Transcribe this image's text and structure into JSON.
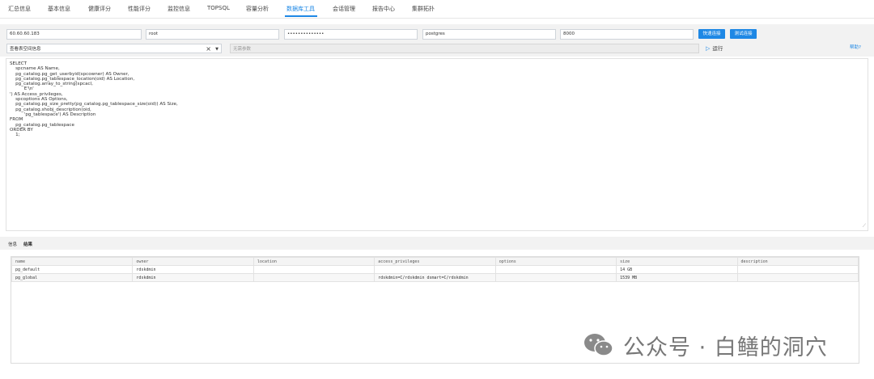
{
  "nav": {
    "tabs": [
      "汇总信息",
      "基本信息",
      "健康评分",
      "性能评分",
      "监控信息",
      "TOPSQL",
      "容量分析",
      "数据库工具",
      "会话管理",
      "报告中心",
      "集群拓扑"
    ],
    "active": "数据库工具"
  },
  "connection": {
    "host": "60.60.60.183",
    "user": "root",
    "password": "••••••••••••••",
    "database": "postgres",
    "port": "8000",
    "quick_connect_label": "快速连接",
    "test_connect_label": "测试连接"
  },
  "query": {
    "selected": "查看表空间信息",
    "params_placeholder": "无需参数",
    "run_label": "运行",
    "help_label": "帮助?"
  },
  "sql": "SELECT\n    spcname AS Name,\n    pg_catalog.pg_get_userbyid(spcowner) AS Owner,\n    pg_catalog.pg_tablespace_location(oid) AS Location,\n    pg_catalog.array_to_string(spcacl,\n          E'\\n'\n') AS Access_privileges,\n    spcoptions AS Options,\n    pg_catalog.pg_size_pretty(pg_catalog.pg_tablespace_size(oid)) AS Size,\n    pg_catalog.shobj_description(oid,\n          'pg_tablespace') AS Description\nFROM\n    pg_catalog.pg_tablespace\nORDER BY\n    1;",
  "result_tabs": [
    "信息",
    "结果"
  ],
  "result_active": "结果",
  "columns": [
    "name",
    "owner",
    "location",
    "access_privileges",
    "options",
    "size",
    "description"
  ],
  "rows": [
    [
      "pg_default",
      "rdskdmin",
      "",
      "",
      "",
      "14 GB",
      ""
    ],
    [
      "pg_global",
      "rdskdmin",
      "",
      "rdskdmin=C/rdskdmin dsmart=C/rdskdmin",
      "",
      "1539 MB",
      ""
    ]
  ],
  "watermark": "公众号 · 白鳝的洞穴",
  "colors": {
    "accent": "#1e88e5",
    "panel": "#f2f2f2"
  },
  "icons": {
    "run": "play-icon",
    "clear": "close-icon",
    "dropdown": "caret-down-icon",
    "watermark": "wechat-icon"
  }
}
